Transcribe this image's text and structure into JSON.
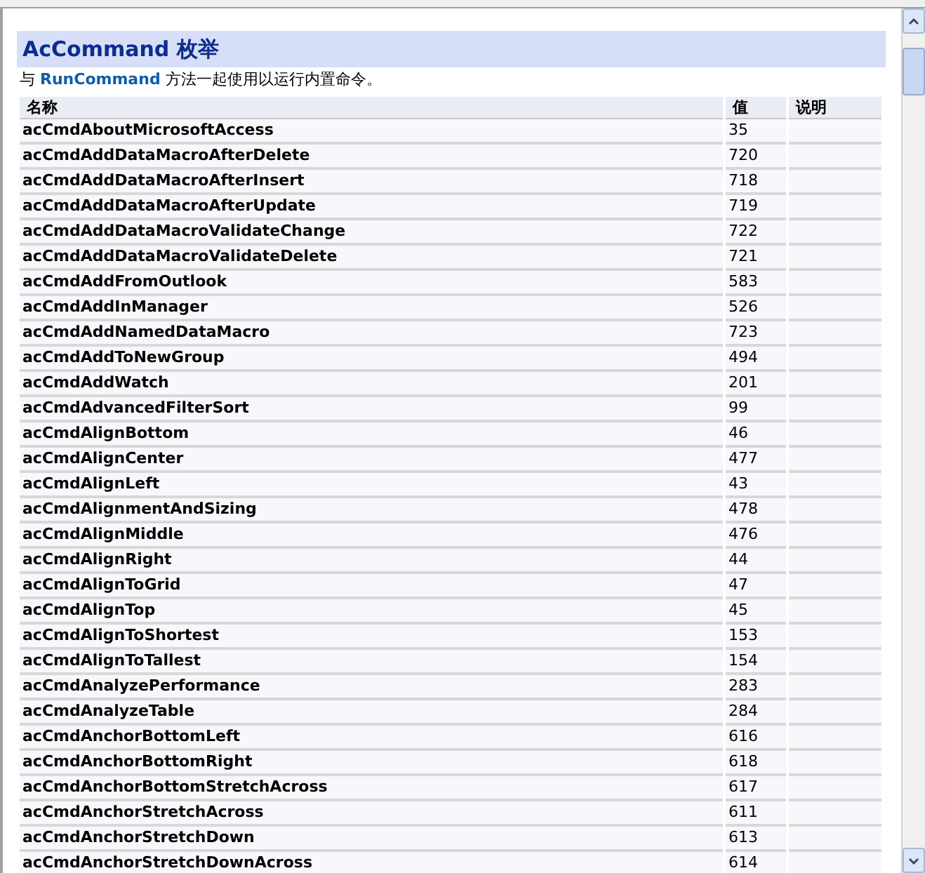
{
  "title": "AcCommand 枚举",
  "intro": {
    "prefix": "与",
    "link": "RunCommand",
    "suffix": "方法一起使用以运行内置命令。"
  },
  "table": {
    "columns": [
      "名称",
      "值",
      "说明"
    ],
    "rows": [
      {
        "name": "acCmdAboutMicrosoftAccess",
        "value": "35"
      },
      {
        "name": "acCmdAddDataMacroAfterDelete",
        "value": "720"
      },
      {
        "name": "acCmdAddDataMacroAfterInsert",
        "value": "718"
      },
      {
        "name": "acCmdAddDataMacroAfterUpdate",
        "value": "719"
      },
      {
        "name": "acCmdAddDataMacroValidateChange",
        "value": "722"
      },
      {
        "name": "acCmdAddDataMacroValidateDelete",
        "value": "721"
      },
      {
        "name": "acCmdAddFromOutlook",
        "value": "583"
      },
      {
        "name": "acCmdAddInManager",
        "value": "526"
      },
      {
        "name": "acCmdAddNamedDataMacro",
        "value": "723"
      },
      {
        "name": "acCmdAddToNewGroup",
        "value": "494"
      },
      {
        "name": "acCmdAddWatch",
        "value": "201"
      },
      {
        "name": "acCmdAdvancedFilterSort",
        "value": "99"
      },
      {
        "name": "acCmdAlignBottom",
        "value": "46"
      },
      {
        "name": "acCmdAlignCenter",
        "value": "477"
      },
      {
        "name": "acCmdAlignLeft",
        "value": "43"
      },
      {
        "name": "acCmdAlignmentAndSizing",
        "value": "478"
      },
      {
        "name": "acCmdAlignMiddle",
        "value": "476"
      },
      {
        "name": "acCmdAlignRight",
        "value": "44"
      },
      {
        "name": "acCmdAlignToGrid",
        "value": "47"
      },
      {
        "name": "acCmdAlignTop",
        "value": "45"
      },
      {
        "name": "acCmdAlignToShortest",
        "value": "153"
      },
      {
        "name": "acCmdAlignToTallest",
        "value": "154"
      },
      {
        "name": "acCmdAnalyzePerformance",
        "value": "283"
      },
      {
        "name": "acCmdAnalyzeTable",
        "value": "284"
      },
      {
        "name": "acCmdAnchorBottomLeft",
        "value": "616"
      },
      {
        "name": "acCmdAnchorBottomRight",
        "value": "618"
      },
      {
        "name": "acCmdAnchorBottomStretchAcross",
        "value": "617"
      },
      {
        "name": "acCmdAnchorStretchAcross",
        "value": "611"
      },
      {
        "name": "acCmdAnchorStretchDown",
        "value": "613"
      },
      {
        "name": "acCmdAnchorStretchDownAcross",
        "value": "614"
      }
    ]
  }
}
